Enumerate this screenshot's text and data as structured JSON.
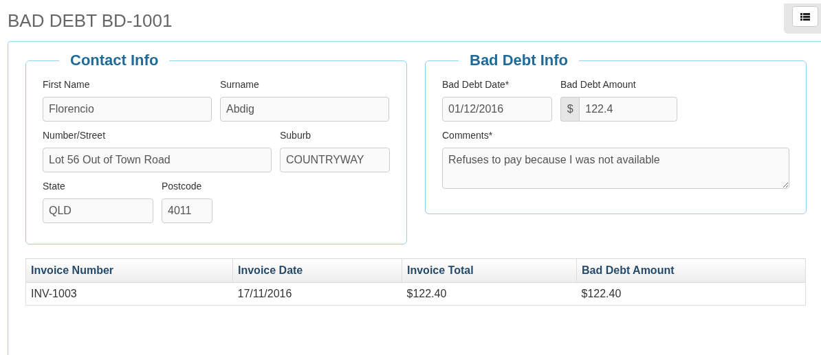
{
  "page_title": "BAD DEBT BD-1001",
  "sections": [
    {
      "legend": "Contact Info",
      "rows": [
        [
          {
            "label": "First Name",
            "value": "Florencio"
          },
          {
            "label": "Surname",
            "value": "Abdig"
          }
        ],
        [
          {
            "label": "Number/Street",
            "value": "Lot 56 Out of Town Road"
          },
          {
            "label": "Suburb",
            "value": "COUNTRYWAY"
          }
        ],
        [
          {
            "label": "State",
            "value": "QLD"
          },
          {
            "label": "Postcode",
            "value": "4011"
          }
        ]
      ]
    },
    {
      "legend": "Bad Debt Info",
      "rows": [
        [
          {
            "label": "Bad Debt Date*",
            "value": "01/12/2016"
          },
          {
            "label": "Bad Debt Amount",
            "value": "122.4",
            "addon": "$"
          }
        ],
        [
          {
            "label": "Comments*",
            "value": "Refuses to pay because I was not available",
            "kind": "textarea"
          }
        ]
      ]
    }
  ],
  "table": {
    "columns": [
      "Invoice Number",
      "Invoice Date",
      "Invoice Total",
      "Bad Debt Amount"
    ],
    "rows": [
      [
        "INV-1003",
        "17/11/2016",
        "$122.40",
        "$122.40"
      ]
    ]
  }
}
